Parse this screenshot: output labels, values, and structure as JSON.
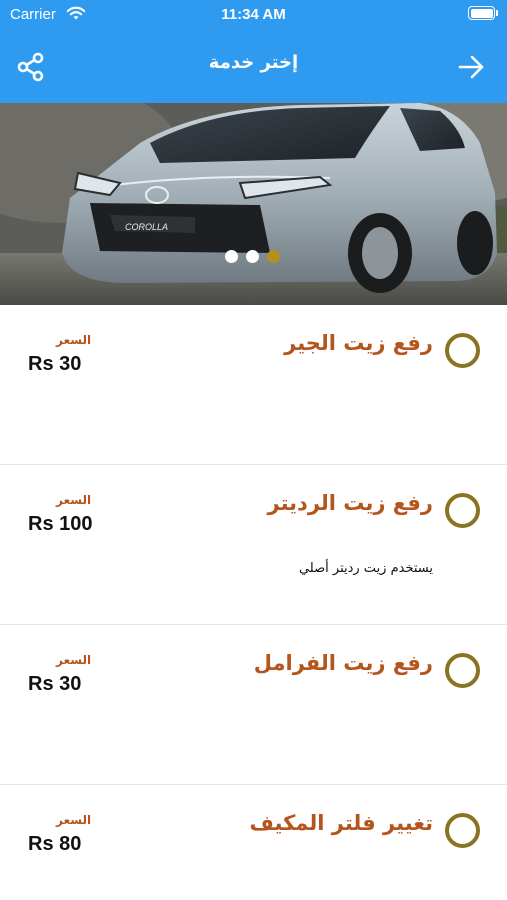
{
  "status_bar": {
    "carrier": "Carrier",
    "time": "11:34 AM"
  },
  "nav": {
    "title": "إختر خدمة",
    "share_icon": "share-icon",
    "forward_icon": "arrow-right-icon"
  },
  "hero": {
    "slides_total": 3,
    "active_slide": 3,
    "badge_text": "COROLLA",
    "accent_color": "#b5901a"
  },
  "services": [
    {
      "name": "رفع زيت الجير",
      "description": "",
      "price_label": "السعر",
      "price": "Rs 30"
    },
    {
      "name": "رفع زيت الرديتر",
      "description": "يستخدم زيت رديتر أصلي",
      "price_label": "السعر",
      "price": "Rs 100"
    },
    {
      "name": "رفع زيت الفرامل",
      "description": "",
      "price_label": "السعر",
      "price": "Rs 30"
    },
    {
      "name": "تغيير فلتر المكيف",
      "description": "",
      "price_label": "السعر",
      "price": "Rs 80"
    }
  ],
  "colors": {
    "header": "#2f9bf0",
    "service_title": "#b5541c",
    "radio_border": "#8a7420"
  }
}
